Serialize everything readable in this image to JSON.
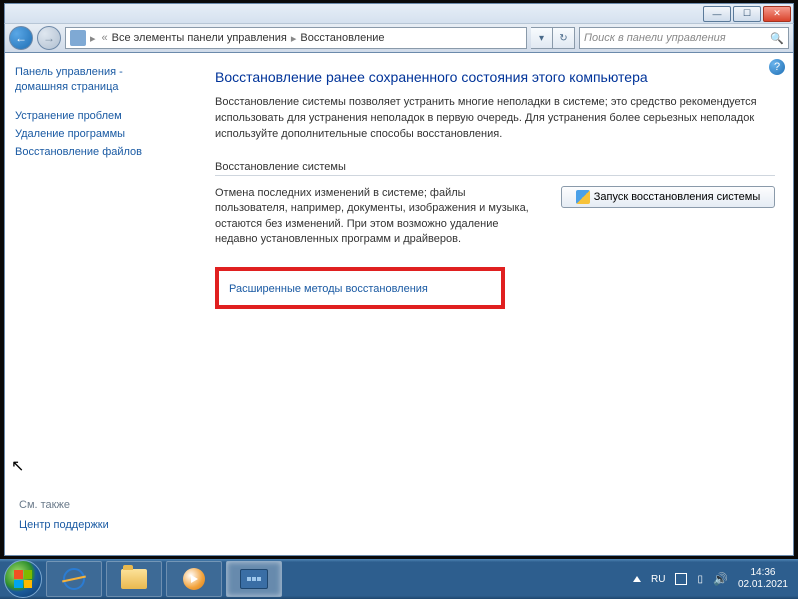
{
  "titlebar": {
    "minimize": "—",
    "maximize": "☐",
    "close": "✕"
  },
  "address": {
    "crumb1": "Все элементы панели управления",
    "crumb2": "Восстановление",
    "search_placeholder": "Поиск в панели управления"
  },
  "sidebar": {
    "home1": "Панель управления -",
    "home2": "домашняя страница",
    "links": [
      "Устранение проблем",
      "Удаление программы",
      "Восстановление файлов"
    ],
    "seealso_hdr": "См. также",
    "seealso_link": "Центр поддержки"
  },
  "content": {
    "h1": "Восстановление ранее сохраненного состояния этого компьютера",
    "desc": "Восстановление системы позволяет устранить многие неполадки в системе; это средство рекомендуется использовать для устранения неполадок в первую очередь. Для устранения более серьезных неполадок используйте дополнительные способы восстановления.",
    "section": "Восстановление системы",
    "row_text": "Отмена последних изменений в системе; файлы пользователя, например, документы, изображения и музыка, остаются без изменений. При этом возможно удаление недавно установленных программ и драйверов.",
    "action_btn": "Запуск восстановления системы",
    "advanced_link": "Расширенные методы восстановления"
  },
  "taskbar": {
    "lang": "RU",
    "time": "14:36",
    "date": "02.01.2021"
  }
}
